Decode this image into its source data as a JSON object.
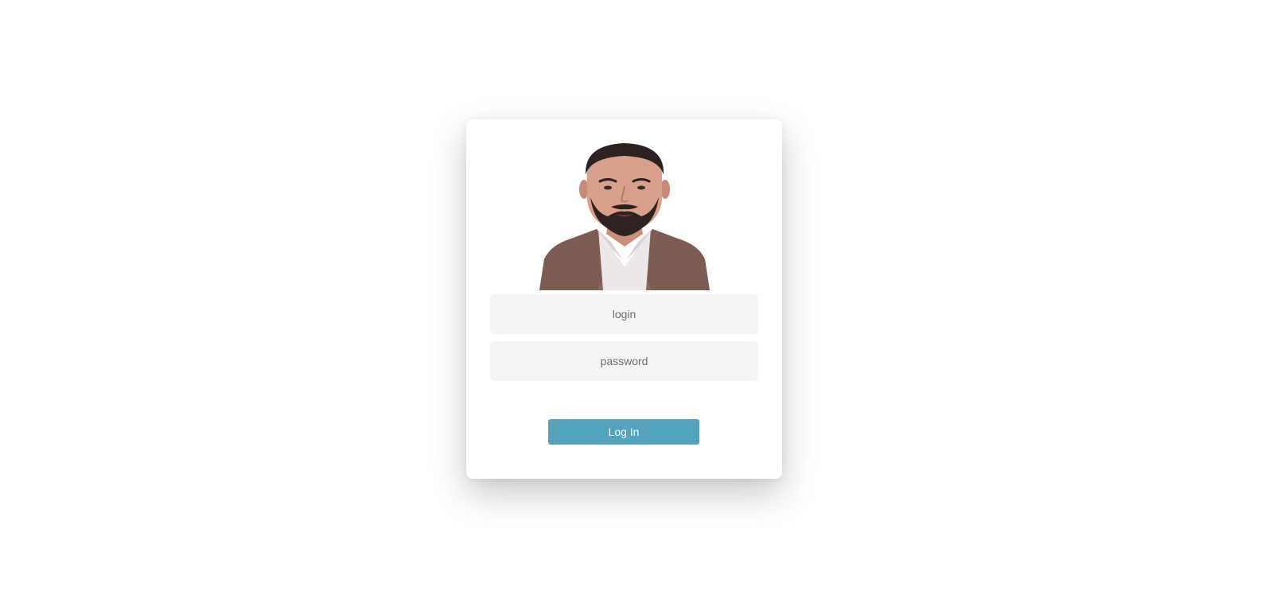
{
  "login_form": {
    "avatar_icon": "user-portrait",
    "login_placeholder": "login",
    "login_value": "",
    "password_placeholder": "password",
    "password_value": "",
    "submit_label": "Log In"
  },
  "colors": {
    "page_background": "#ffffff",
    "card_background": "#ffffff",
    "input_background": "#f4f4f4",
    "button_background": "#52a3bb",
    "button_text": "#ffffff"
  }
}
